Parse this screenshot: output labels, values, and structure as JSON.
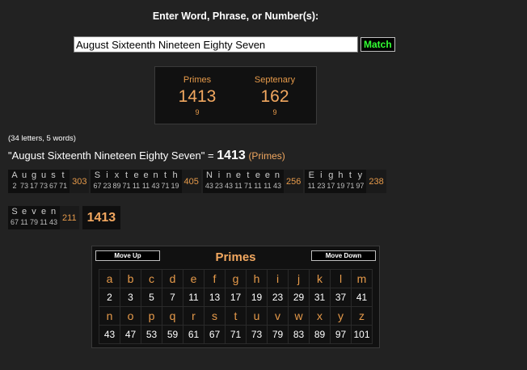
{
  "header": {
    "title": "Enter Word, Phrase, or Number(s):"
  },
  "search": {
    "value": "August Sixteenth Nineteen Eighty Seven",
    "button_label": "Match"
  },
  "summary": {
    "primes": {
      "name": "Primes",
      "value": "1413",
      "reduction": "9"
    },
    "septenary": {
      "name": "Septenary",
      "value": "162",
      "reduction": "9"
    }
  },
  "counts_text": "(34 letters, 5 words)",
  "phrase_line": {
    "quoted": "\"August Sixteenth Nineteen Eighty Seven\" =",
    "total": "1413",
    "cipher": "(Primes)"
  },
  "breakdown": {
    "words": [
      {
        "letters": [
          "A",
          "u",
          "g",
          "u",
          "s",
          "t"
        ],
        "values": [
          "2",
          "73",
          "17",
          "73",
          "67",
          "71"
        ],
        "sum": "303"
      },
      {
        "letters": [
          "S",
          "i",
          "x",
          "t",
          "e",
          "e",
          "n",
          "t",
          "h"
        ],
        "values": [
          "67",
          "23",
          "89",
          "71",
          "11",
          "11",
          "43",
          "71",
          "19"
        ],
        "sum": "405"
      },
      {
        "letters": [
          "N",
          "i",
          "n",
          "e",
          "t",
          "e",
          "e",
          "n"
        ],
        "values": [
          "43",
          "23",
          "43",
          "11",
          "71",
          "11",
          "11",
          "43"
        ],
        "sum": "256"
      },
      {
        "letters": [
          "E",
          "i",
          "g",
          "h",
          "t",
          "y"
        ],
        "values": [
          "11",
          "23",
          "17",
          "19",
          "71",
          "97"
        ],
        "sum": "238"
      },
      {
        "letters": [
          "S",
          "e",
          "v",
          "e",
          "n"
        ],
        "values": [
          "67",
          "11",
          "79",
          "11",
          "43"
        ],
        "sum": "211"
      }
    ],
    "grand_total": "1413"
  },
  "cipher_table": {
    "title": "Primes",
    "move_up_label": "Move Up",
    "move_down_label": "Move Down",
    "rows": [
      {
        "letters": [
          "a",
          "b",
          "c",
          "d",
          "e",
          "f",
          "g",
          "h",
          "i",
          "j",
          "k",
          "l",
          "m"
        ],
        "values": [
          "2",
          "3",
          "5",
          "7",
          "11",
          "13",
          "17",
          "19",
          "23",
          "29",
          "31",
          "37",
          "41"
        ]
      },
      {
        "letters": [
          "n",
          "o",
          "p",
          "q",
          "r",
          "s",
          "t",
          "u",
          "v",
          "w",
          "x",
          "y",
          "z"
        ],
        "values": [
          "43",
          "47",
          "53",
          "59",
          "61",
          "67",
          "71",
          "73",
          "79",
          "83",
          "89",
          "97",
          "101"
        ]
      }
    ]
  }
}
